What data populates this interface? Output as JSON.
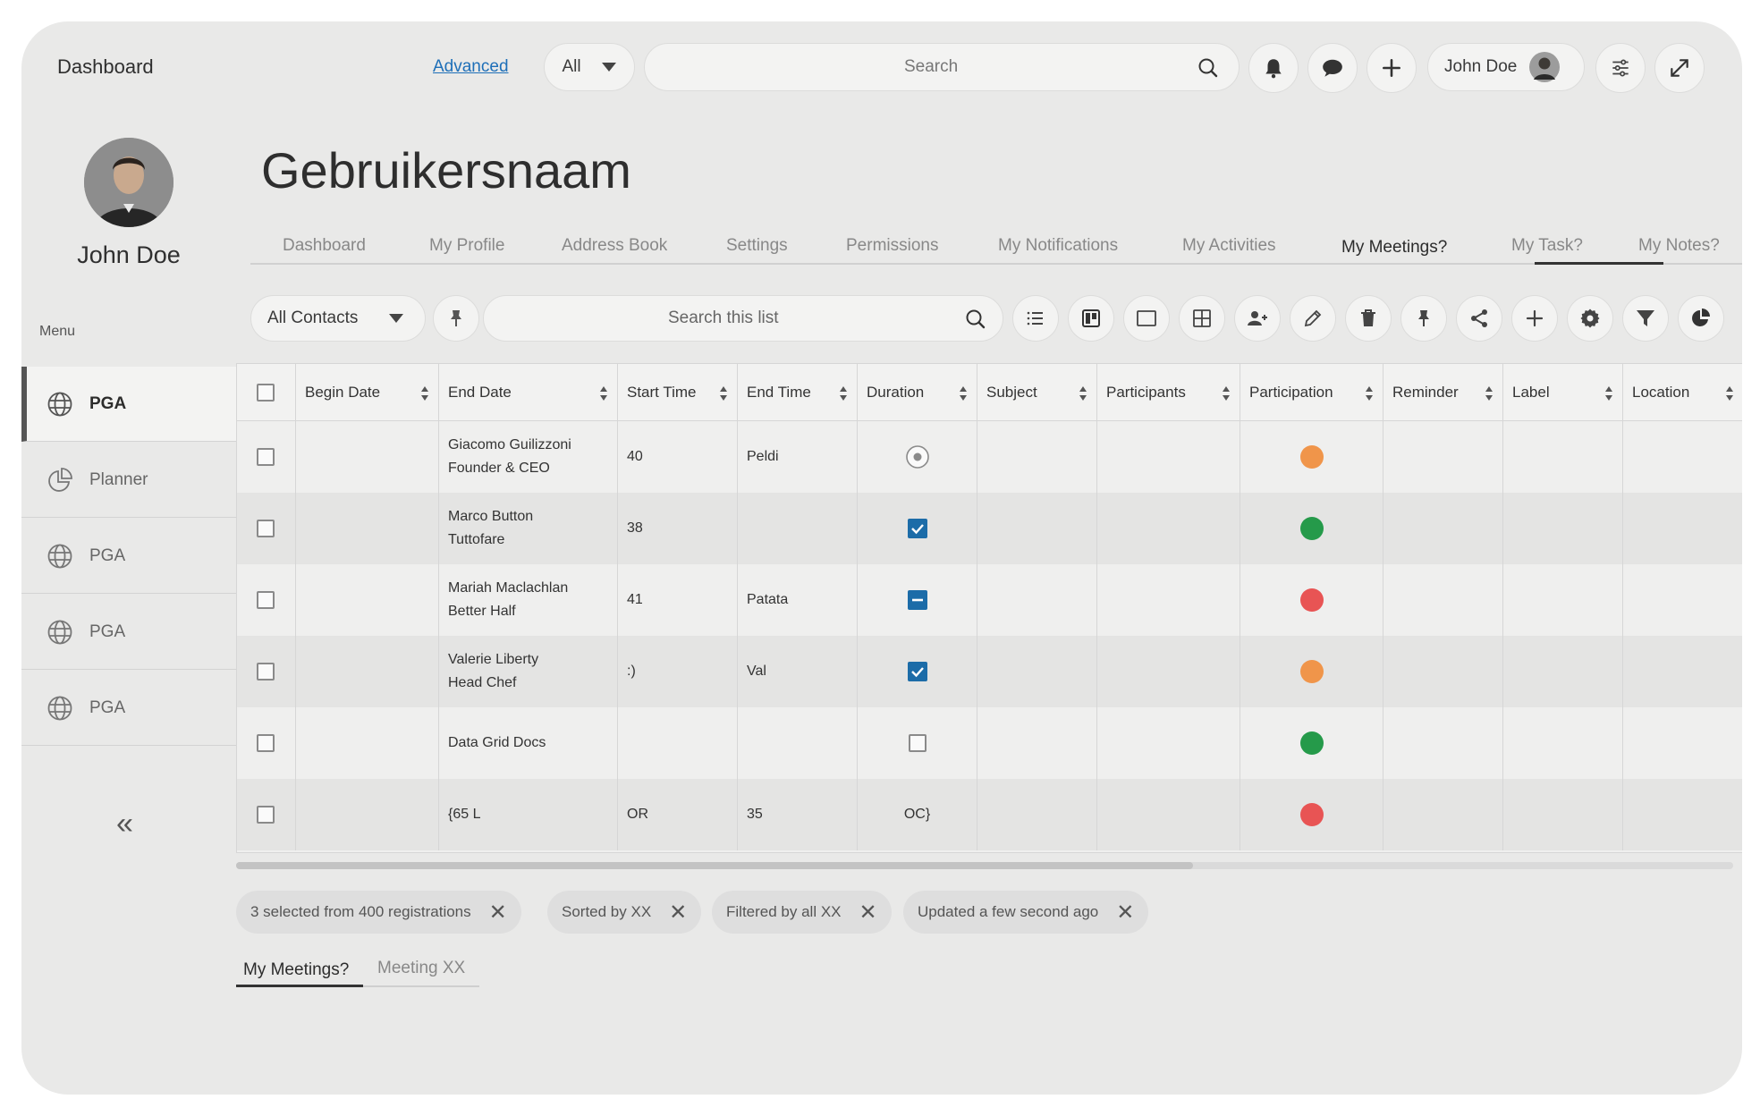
{
  "header": {
    "title": "Dashboard",
    "advanced_link": "Advanced",
    "filter_select": "All",
    "search_placeholder": "Search",
    "user_name": "John Doe"
  },
  "sidebar": {
    "profile_name": "John Doe",
    "menu_label": "Menu",
    "items": [
      {
        "label": "PGA",
        "icon": "globe-icon",
        "active": true
      },
      {
        "label": "Planner",
        "icon": "pie-chart-icon",
        "active": false
      },
      {
        "label": "PGA",
        "icon": "globe-icon",
        "active": false
      },
      {
        "label": "PGA",
        "icon": "globe-icon",
        "active": false
      },
      {
        "label": "PGA",
        "icon": "globe-icon",
        "active": false
      }
    ],
    "collapse_label": "«"
  },
  "main": {
    "title": "Gebruikersnaam",
    "tabs": [
      "Dashboard",
      "My Profile",
      "Address Book",
      "Settings",
      "Permissions",
      "My Notifications",
      "My Activities",
      "My Meetings?",
      "My Task?",
      "My Notes?"
    ],
    "active_tab": "My Meetings?",
    "toolbar": {
      "contacts_select": "All Contacts",
      "list_search_placeholder": "Search this list",
      "icons": [
        "list-icon",
        "kanban-icon",
        "single-view-icon",
        "grid-icon",
        "add-user-icon",
        "edit-icon",
        "delete-icon",
        "pin-icon",
        "share-icon",
        "add-icon",
        "settings-icon",
        "filter-icon",
        "pie-chart-icon"
      ]
    }
  },
  "table": {
    "columns": [
      "Begin Date",
      "End Date",
      "Start Time",
      "End Time",
      "Duration",
      "Subject",
      "Participants",
      "Participation",
      "Reminder",
      "Label",
      "Location"
    ],
    "rows": [
      {
        "end_date": [
          "Giacomo Guilizzoni",
          "Founder & CEO"
        ],
        "start_time": "40",
        "end_time": "Peldi",
        "duration": "radio",
        "participation": "#f0954a"
      },
      {
        "end_date": [
          "Marco Button",
          "Tuttofare"
        ],
        "start_time": "38",
        "end_time": "",
        "duration": "checked",
        "participation": "#259a4a"
      },
      {
        "end_date": [
          "Mariah Maclachlan",
          "Better Half"
        ],
        "start_time": "41",
        "end_time": "Patata",
        "duration": "indeterminate",
        "participation": "#e85454"
      },
      {
        "end_date": [
          "Valerie Liberty",
          "Head Chef"
        ],
        "start_time": ":)",
        "end_time": "Val",
        "duration": "checked",
        "participation": "#f0954a"
      },
      {
        "end_date": [
          "Data Grid Docs"
        ],
        "start_time": "",
        "end_time": "",
        "duration": "unchecked",
        "participation": "#259a4a"
      },
      {
        "end_date": [
          "{65 L"
        ],
        "start_time": "OR",
        "end_time": "35",
        "duration": "OC}",
        "participation": "#e85454"
      }
    ]
  },
  "status_chips": [
    "3 selected from 400 registrations",
    "Sorted by XX",
    "Filtered by all XX",
    "Updated a few second ago"
  ],
  "bottom_tabs": [
    "My Meetings?",
    "Meeting XX"
  ],
  "colors": {
    "accent_blue": "#1c6ca8",
    "orange": "#f0954a",
    "green": "#259a4a",
    "red": "#e85454",
    "background": "#e9e9e8"
  }
}
